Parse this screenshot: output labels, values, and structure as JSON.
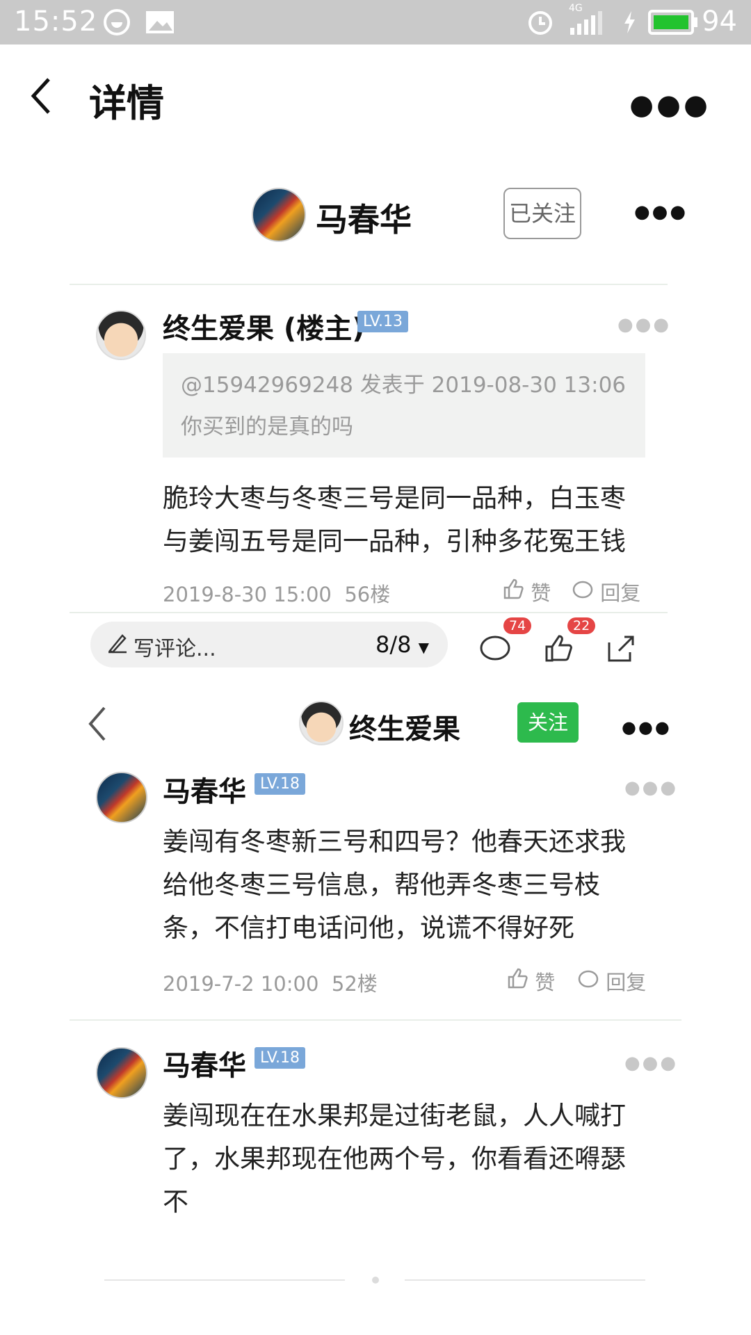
{
  "status_bar": {
    "time": "15:52",
    "network": "4G",
    "battery": "94"
  },
  "header": {
    "title": "详情"
  },
  "shot1": {
    "author_name": "马春华",
    "follow_label": "已关注",
    "reply": {
      "name": "终生爱果 (楼主)",
      "level": "LV.13",
      "quote_line1": "@15942969248 发表于 2019-08-30 13:06",
      "quote_line2": "你买到的是真的吗",
      "text_line1": "脆玲大枣与冬枣三号是同一品种，白玉枣",
      "text_line2": "与姜闯五号是同一品种，引种多花冤王钱",
      "time": "2019-8-30 15:00",
      "floor": "56楼",
      "like": "赞",
      "reply_label": "回复"
    },
    "input_placeholder": "写评论...",
    "page_indicator": "8/8",
    "comment_count": "74",
    "like_count": "22"
  },
  "shot2": {
    "author_name": "终生爱果",
    "follow_label": "关注",
    "replies": [
      {
        "name": "马春华",
        "level": "LV.18",
        "lines": [
          "姜闯有冬枣新三号和四号？他春天还求我",
          "给他冬枣三号信息，帮他弄冬枣三号枝",
          "条，不信打电话问他，说谎不得好死"
        ],
        "time": "2019-7-2 10:00",
        "floor": "52楼",
        "like": "赞",
        "reply_label": "回复"
      },
      {
        "name": "马春华",
        "level": "LV.18",
        "lines": [
          "姜闯现在在水果邦是过街老鼠，人人喊打",
          "了，水果邦现在他两个号，你看看还嘚瑟",
          "不"
        ]
      }
    ]
  }
}
